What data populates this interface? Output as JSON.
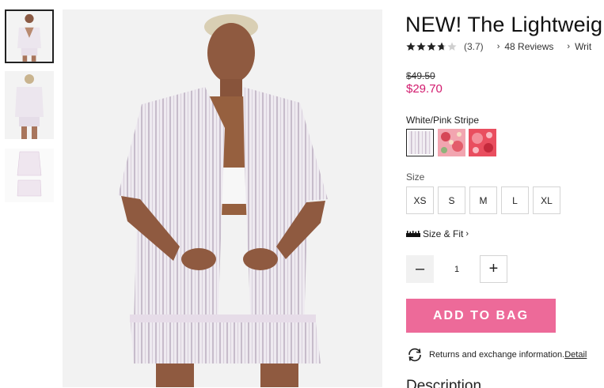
{
  "product": {
    "title": "NEW! The Lightweight",
    "rating": 3.7,
    "rating_text": "(3.7)",
    "reviews_link": "48 Reviews",
    "write_link": "Writ",
    "price_original": "$49.50",
    "price_sale": "$29.70"
  },
  "color": {
    "selected_label": "White/Pink Stripe",
    "swatches": [
      "White/Pink Stripe",
      "Pink Floral",
      "Red Floral"
    ]
  },
  "size": {
    "label": "Size",
    "options": [
      "XS",
      "S",
      "M",
      "L",
      "XL"
    ]
  },
  "fit": {
    "label": "Size & Fit"
  },
  "quantity": {
    "value": "1",
    "minus": "–",
    "plus": "+"
  },
  "cta": {
    "add_to_bag": "ADD TO BAG"
  },
  "returns": {
    "text": "Returns and exchange information.",
    "link": "Detail"
  },
  "description": {
    "heading": "Description"
  },
  "colors": {
    "accent": "#ed6a99",
    "sale": "#d21b6e",
    "star": "#222222"
  },
  "icons": [
    "star-icon",
    "chevron-right-icon",
    "ruler-icon",
    "minus-icon",
    "plus-icon",
    "returns-icon"
  ]
}
